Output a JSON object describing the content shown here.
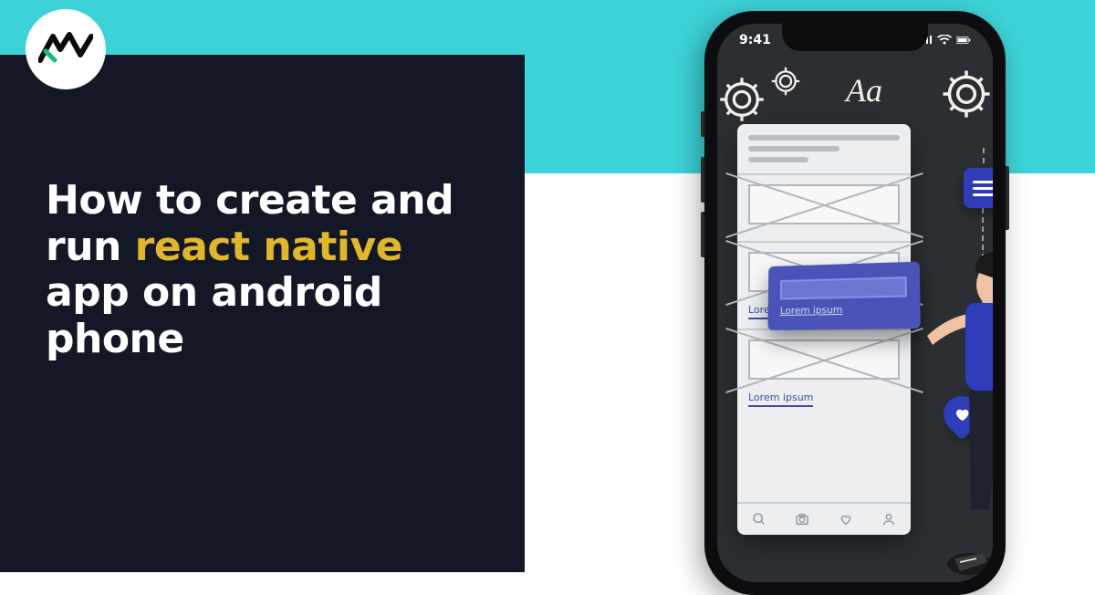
{
  "colors": {
    "teal": "#3cd3d8",
    "dark": "#131726",
    "accent": "#e0b62c",
    "indigo": "#3d4aa8"
  },
  "logo": {
    "alt": "4way-logo"
  },
  "headline": {
    "line1": "How to create and",
    "line2_before": "run ",
    "line2_highlight": "react native",
    "line3": "app on android",
    "line4": "phone"
  },
  "phone": {
    "status_time": "9:41",
    "typography_label": "Aa"
  },
  "wireframe": {
    "placeholder1": "Lorem ipsum",
    "placeholder2": "Lorem ipsum",
    "placeholder3": "Lorem ipsum"
  },
  "floating_card": {
    "text": "Lorem ipsum"
  }
}
